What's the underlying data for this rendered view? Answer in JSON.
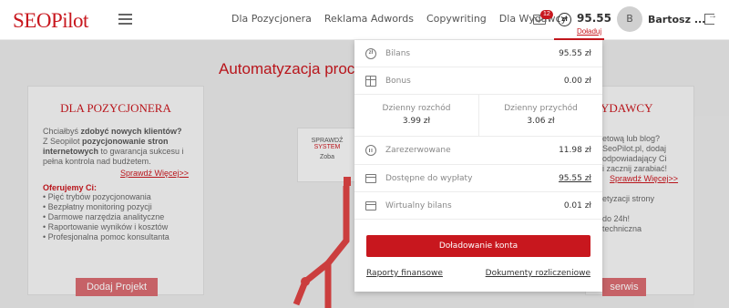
{
  "header": {
    "logo_seo": "SEO",
    "logo_pilot": "Pilot",
    "nav": [
      "Dla Pozycjonera",
      "Reklama Adwords",
      "Copywriting",
      "Dla Wydawcy"
    ],
    "mail_badge": "12",
    "coin_symbol": "zł",
    "balance": "95.55",
    "topup_link": "Doładuj",
    "avatar_initial": "B",
    "username": "Bartosz ..."
  },
  "page": {
    "title": "Automatyzacja proc",
    "left_card": {
      "heading": "DLA POZYCJONERA",
      "intro_1": "Chciałbyś ",
      "intro_bold_1": "zdobyć nowych klientów?",
      "intro_2": " Z Seopilot ",
      "intro_bold_2": "pozycjonowanie stron internetowych",
      "intro_3": " to gwarancja sukcesu i pełna kontrola nad budżetem.",
      "link": "Sprawdź Więcej>>",
      "offer_title": "Oferujemy Ci:",
      "offer_items": [
        "• Pięć trybów pozycjonowania",
        "• Bezpłatny monitoring pozycji",
        "• Darmowe narzędzia analityczne",
        "• Raportowanie wyników i kosztów",
        "• Profesjonalna pomoc konsultanta"
      ],
      "button": "Dodaj Projekt"
    },
    "center_box": {
      "line1": "SPRAWDŹ",
      "line2": "SYSTEM",
      "line3": "Zoba"
    },
    "right_card": {
      "heading": "YDAWCY",
      "lines": [
        "etową lub blog?",
        "SeoPilot.pl, dodaj",
        "odpowiadający Ci",
        "i zacznij zarabiać!"
      ],
      "link": "Sprawdź Więcej>>",
      "lines2": [
        "etyzacji strony",
        "",
        "do 24h!",
        "techniczna"
      ],
      "button": "serwis"
    }
  },
  "dropdown": {
    "bilans_label": "Bilans",
    "bilans_value": "95.55 zł",
    "bonus_label": "Bonus",
    "bonus_value": "0.00 zł",
    "daily_expense_label": "Dzienny rozchód",
    "daily_expense_value": "3.99 zł",
    "daily_income_label": "Dzienny przychód",
    "daily_income_value": "3.06 zł",
    "reserved_label": "Zarezerwowane",
    "reserved_value": "11.98 zł",
    "withdraw_label": "Dostępne do wypłaty",
    "withdraw_value": "95.55 zł",
    "virtual_label": "Wirtualny bilans",
    "virtual_value": "0.01 zł",
    "topup_button": "Doładowanie konta",
    "reports_link": "Raporty finansowe",
    "documents_link": "Dokumenty rozliczeniowe"
  },
  "colors": {
    "accent": "#c8171e",
    "button_faded": "#d76b70"
  }
}
